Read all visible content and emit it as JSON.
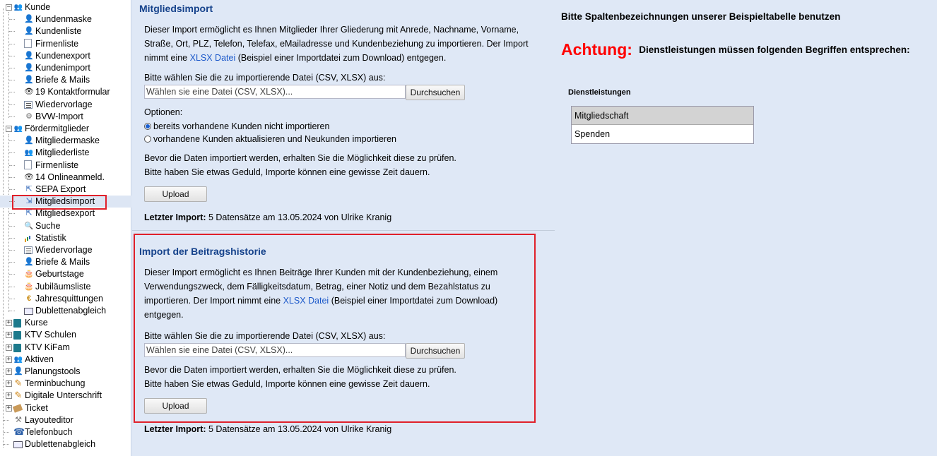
{
  "sidebar": {
    "items": [
      {
        "label": "Kunde",
        "level": 0,
        "icon": "group-icon",
        "expander": "−"
      },
      {
        "label": "Kundenmaske",
        "level": 1,
        "icon": "person-icon"
      },
      {
        "label": "Kundenliste",
        "level": 1,
        "icon": "person-icon"
      },
      {
        "label": "Firmenliste",
        "level": 1,
        "icon": "document-icon"
      },
      {
        "label": "Kundenexport",
        "level": 1,
        "icon": "person-icon"
      },
      {
        "label": "Kundenimport",
        "level": 1,
        "icon": "person-icon"
      },
      {
        "label": "Briefe & Mails",
        "level": 1,
        "icon": "person-icon"
      },
      {
        "label": "19  Kontaktformular",
        "level": 1,
        "icon": "eye-icon"
      },
      {
        "label": "Wiedervorlage",
        "level": 1,
        "icon": "list-icon"
      },
      {
        "label": "BVW-Import",
        "level": 1,
        "icon": "gear-icon"
      },
      {
        "label": "Fördermitglieder",
        "level": 0,
        "icon": "group-icon",
        "expander": "−"
      },
      {
        "label": "Mitgliedermaske",
        "level": 1,
        "icon": "person-icon"
      },
      {
        "label": "Mitgliederliste",
        "level": 1,
        "icon": "group-icon"
      },
      {
        "label": "Firmenliste",
        "level": 1,
        "icon": "document-icon"
      },
      {
        "label": "14  Onlineanmeld.",
        "level": 1,
        "icon": "eye-icon"
      },
      {
        "label": "SEPA Export",
        "level": 1,
        "icon": "export-icon"
      },
      {
        "label": "Mitgliedsimport",
        "level": 1,
        "icon": "import-icon",
        "selected": true
      },
      {
        "label": "Mitgliedsexport",
        "level": 1,
        "icon": "export-icon"
      },
      {
        "label": "Suche",
        "level": 1,
        "icon": "search-icon"
      },
      {
        "label": "Statistik",
        "level": 1,
        "icon": "chart-icon"
      },
      {
        "label": "Wiedervorlage",
        "level": 1,
        "icon": "list-icon"
      },
      {
        "label": "Briefe & Mails",
        "level": 1,
        "icon": "person-icon"
      },
      {
        "label": "Geburtstage",
        "level": 1,
        "icon": "cake-icon"
      },
      {
        "label": "Jubiläumsliste",
        "level": 1,
        "icon": "cake-icon"
      },
      {
        "label": "Jahresquittungen",
        "level": 1,
        "icon": "coin-icon"
      },
      {
        "label": "Dublettenabgleich",
        "level": 1,
        "icon": "duplicate-icon"
      },
      {
        "label": "Kurse",
        "level": 0,
        "icon": "book-icon",
        "expander": "+"
      },
      {
        "label": "KTV Schulen",
        "level": 0,
        "icon": "book-icon",
        "expander": "+"
      },
      {
        "label": "KTV KiFam",
        "level": 0,
        "icon": "book-icon",
        "expander": "+"
      },
      {
        "label": "Aktiven",
        "level": 0,
        "icon": "group-icon",
        "expander": "+"
      },
      {
        "label": "Planungstools",
        "level": 0,
        "icon": "person-icon",
        "expander": "+"
      },
      {
        "label": "Terminbuchung",
        "level": 0,
        "icon": "pen-icon",
        "expander": "+"
      },
      {
        "label": "Digitale Unterschrift",
        "level": 0,
        "icon": "pen-icon",
        "expander": "+"
      },
      {
        "label": "Ticket",
        "level": 0,
        "icon": "ticket-icon",
        "expander": "+"
      },
      {
        "label": "Layouteditor",
        "level": 0,
        "icon": "tool-icon"
      },
      {
        "label": "Telefonbuch",
        "level": 0,
        "icon": "phone-icon"
      },
      {
        "label": "Dublettenabgleich",
        "level": 0,
        "icon": "duplicate-icon"
      }
    ]
  },
  "import1": {
    "title": "Mitgliedsimport",
    "desc_line1": "Dieser Import ermöglicht es Ihnen Mitglieder Ihrer Gliederung mit Anrede, Nachname, Vorname,",
    "desc_line2": "Straße, Ort, PLZ, Telefon, Telefax, eMailadresse und Kundenbeziehung zu importieren. Der Import",
    "desc_line3_pre": "nimmt eine ",
    "desc_link": "XLSX Datei",
    "desc_line3_post": " (Beispiel einer Importdatei zum Download) entgegen.",
    "file_label": "Bitte wählen Sie die zu importierende Datei (CSV, XLSX) aus:",
    "file_placeholder": "Wählen sie eine Datei (CSV, XLSX)...",
    "browse_label": "Durchsuchen",
    "options_label": "Optionen:",
    "option1": "bereits vorhandene Kunden nicht importieren",
    "option2": "vorhandene Kunden aktualisieren und Neukunden importieren",
    "info1": "Bevor die Daten importiert werden, erhalten Sie die Möglichkeit diese zu prüfen.",
    "info2": "Bitte haben Sie etwas Geduld, Importe können eine gewisse Zeit dauern.",
    "upload_label": "Upload",
    "last_import_label": "Letzter Import:",
    "last_import_value": " 5 Datensätze am 13.05.2024 von Ulrike Kranig"
  },
  "import2": {
    "title": "Import der Beitragshistorie",
    "desc_line1": "Dieser Import ermöglicht es Ihnen Beiträge Ihrer Kunden mit der Kundenbeziehung, einem",
    "desc_line2": "Verwendungszweck, dem Fälligkeitsdatum, Betrag, einer Notiz und dem Bezahlstatus zu",
    "desc_line3_pre": "importieren. Der Import nimmt eine ",
    "desc_link": "XLSX Datei",
    "desc_line3_post": " (Beispiel einer Importdatei zum Download)",
    "desc_line4": "entgegen.",
    "file_label": "Bitte wählen Sie die zu importierende Datei (CSV, XLSX) aus:",
    "file_placeholder": "Wählen sie eine Datei (CSV, XLSX)...",
    "browse_label": "Durchsuchen",
    "info1": "Bevor die Daten importiert werden, erhalten Sie die Möglichkeit diese zu prüfen.",
    "info2": "Bitte haben Sie etwas Geduld, Importe können eine gewisse Zeit dauern.",
    "upload_label": "Upload",
    "last_import_label": "Letzter Import:",
    "last_import_value": " 5 Datensätze am 13.05.2024 von Ulrike Kranig"
  },
  "right": {
    "heading": "Bitte Spaltenbezeichnungen unserer Beispieltabelle benutzen",
    "attention_word": "Achtung:",
    "attention_text": "Dienstleistungen müssen folgenden Begriffen entsprechen:",
    "table_label": "Dienstleistungen",
    "rows": [
      "Mitgliedschaft",
      "Spenden"
    ],
    "attention_color": "#ff0000"
  }
}
